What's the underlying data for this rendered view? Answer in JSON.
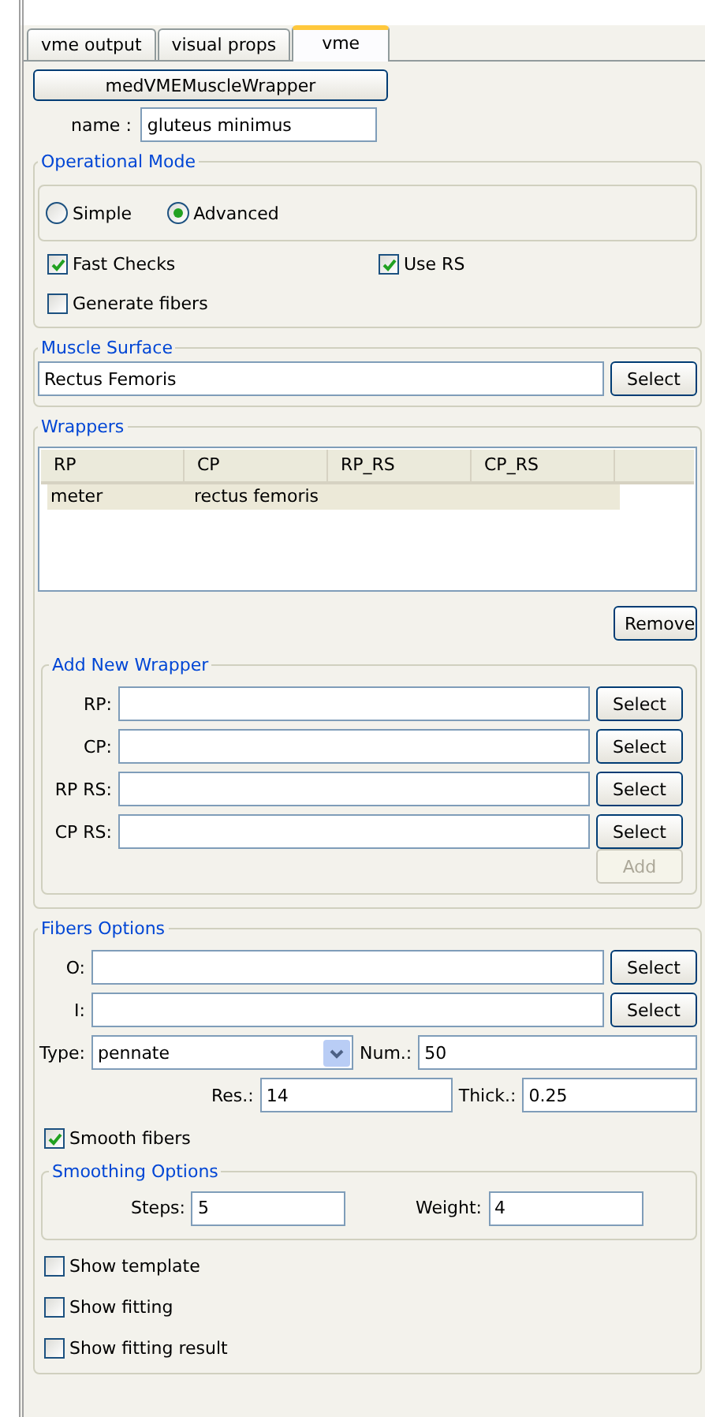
{
  "tabs": [
    {
      "label": "vme output",
      "selected": false
    },
    {
      "label": "visual props",
      "selected": false
    },
    {
      "label": "vme",
      "selected": true
    }
  ],
  "wrapper_button": "medVMEMuscleWrapper",
  "name": {
    "label": "name :",
    "value": "gluteus minimus"
  },
  "operational_mode": {
    "title": "Operational Mode",
    "modes": [
      {
        "label": "Simple",
        "selected": false
      },
      {
        "label": "Advanced",
        "selected": true
      }
    ],
    "options": [
      {
        "label": "Fast Checks",
        "checked": true
      },
      {
        "label": "Use RS",
        "checked": true
      },
      {
        "label": "Generate fibers",
        "checked": false
      }
    ]
  },
  "muscle_surface": {
    "title": "Muscle Surface",
    "value": "Rectus Femoris",
    "button": "Select"
  },
  "wrappers": {
    "title": "Wrappers",
    "columns": [
      "RP",
      "CP",
      "RP_RS",
      "CP_RS"
    ],
    "rows": [
      {
        "cells": [
          "meter",
          "rectus femoris"
        ],
        "selected": true
      }
    ],
    "remove_button": "Remove"
  },
  "add_new_wrapper": {
    "title": "Add New Wrapper",
    "fields": [
      {
        "label": "RP:",
        "button": "Select"
      },
      {
        "label": "CP:",
        "button": "Select"
      },
      {
        "label": "RP RS:",
        "button": "Select"
      },
      {
        "label": "CP RS:",
        "button": "Select"
      }
    ],
    "add_button": {
      "label": "Add",
      "disabled": true
    }
  },
  "fibers_options": {
    "title": "Fibers Options",
    "fields": [
      {
        "label": "O:",
        "button": "Select"
      },
      {
        "label": "I:",
        "button": "Select"
      }
    ],
    "type": {
      "label": "Type:",
      "value": "pennate"
    },
    "num": {
      "label": "Num.:",
      "value": "50"
    },
    "res": {
      "label": "Res.:",
      "value": "14"
    },
    "thick": {
      "label": "Thick.:",
      "value": "0.25"
    },
    "smooth_fibers": {
      "label": "Smooth fibers",
      "checked": true
    },
    "smoothing_options": {
      "title": "Smoothing Options",
      "steps": {
        "label": "Steps:",
        "value": "5"
      },
      "weight": {
        "label": "Weight:",
        "value": "4"
      }
    },
    "display_options": [
      {
        "label": "Show template",
        "checked": false
      },
      {
        "label": "Show fitting",
        "checked": false
      },
      {
        "label": "Show fitting result",
        "checked": false
      }
    ]
  }
}
